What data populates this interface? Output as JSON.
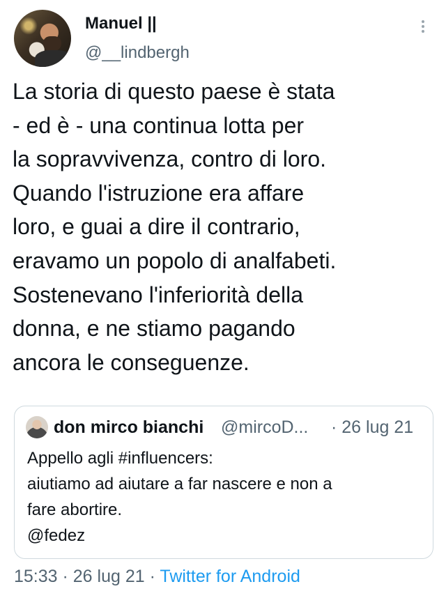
{
  "author": {
    "display_name": "Manuel ||",
    "username": "@__lindbergh",
    "more_icon": "more-vertical-icon"
  },
  "tweet": {
    "lines": [
      "La storia di questo paese è stata",
      "- ed è - una continua lotta per",
      "la sopravvivenza, contro di loro.",
      "Quando l'istruzione era affare",
      "loro, e guai a dire il contrario,",
      "eravamo un popolo di analfabeti.",
      "Sostenevano l'inferiorità della",
      "donna, e ne stiamo pagando",
      "ancora le conseguenze."
    ]
  },
  "quoted_tweet": {
    "display_name": "don mirco bianchi",
    "username": "@mircoD...",
    "date": "· 26 lug 21",
    "lines": [
      "Appello agli #influencers:",
      "aiutiamo ad aiutare a far nascere e non a",
      "fare abortire.",
      "@fedez"
    ]
  },
  "meta": {
    "time": "15:33",
    "separator1": " · ",
    "date": "26 lug 21",
    "separator2": " · ",
    "source": "Twitter for Android"
  },
  "colors": {
    "text": "#0f1419",
    "secondary": "#536471",
    "link": "#1d9bf0",
    "border": "#cfd9de"
  }
}
